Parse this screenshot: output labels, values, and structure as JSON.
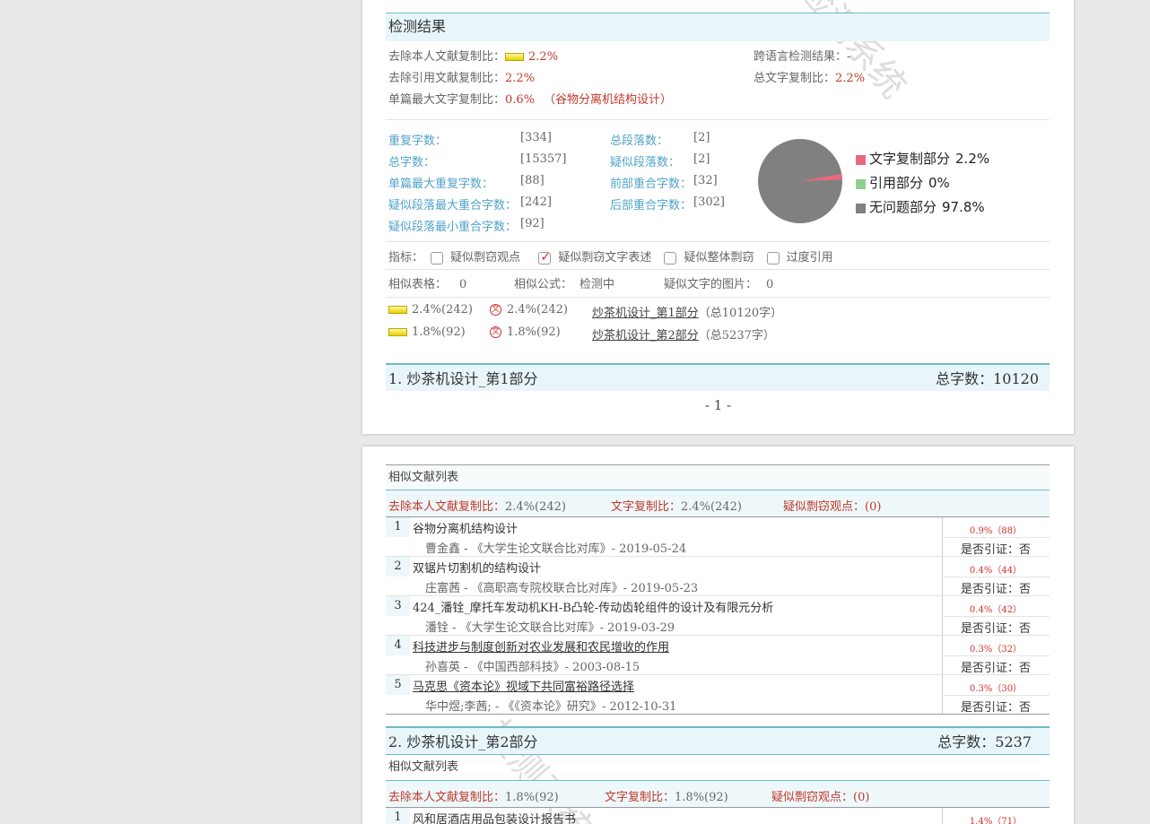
{
  "watermark_text": "检测系统",
  "page1": {
    "section_title": "检测结果",
    "summary": {
      "exclude_self_label": "去除本人文献复制比：",
      "exclude_self_value": "2.2%",
      "cross_lang_label": "跨语言检测结果：",
      "cross_lang_value": "-",
      "exclude_ref_label": "去除引用文献复制比：",
      "exclude_ref_value": "2.2%",
      "total_text_label": "总文字复制比：",
      "total_text_value": "2.2%",
      "single_max_label": "单篇最大文字复制比：",
      "single_max_value": "0.6%",
      "single_max_title": "（谷物分离机结构设计）"
    },
    "stats": {
      "dup_chars_label": "重复字数：",
      "dup_chars_value": "[334]",
      "total_paras_label": "总段落数：",
      "total_paras_value": "[2]",
      "total_chars_label": "总字数：",
      "total_chars_value": "[15357]",
      "sus_paras_label": "疑似段落数：",
      "sus_paras_value": "[2]",
      "single_max_dup_label": "单篇最大重复字数：",
      "single_max_dup_value": "[88]",
      "front_overlap_label": "前部重合字数：",
      "front_overlap_value": "[32]",
      "sus_para_max_label": "疑似段落最大重合字数：",
      "sus_para_max_value": "[242]",
      "back_overlap_label": "后部重合字数：",
      "back_overlap_value": "[302]",
      "sus_para_min_label": "疑似段落最小重合字数：",
      "sus_para_min_value": "[92]"
    },
    "chart_data": {
      "type": "pie",
      "title": "",
      "slices": [
        {
          "label": "文字复制部分",
          "value": 2.2,
          "color": "#e8697d",
          "display": "2.2%"
        },
        {
          "label": "引用部分",
          "value": 0,
          "color": "#8fcf8f",
          "display": "0%"
        },
        {
          "label": "无问题部分",
          "value": 97.8,
          "color": "#808080",
          "display": "97.8%"
        }
      ]
    },
    "indicators": {
      "label": "指标：",
      "items": [
        {
          "text": "疑似剽窃观点",
          "checked": false
        },
        {
          "text": "疑似剽窃文字表述",
          "checked": true
        },
        {
          "text": "疑似整体剽窃",
          "checked": false
        },
        {
          "text": "过度引用",
          "checked": false
        }
      ]
    },
    "similar": {
      "tables_label": "相似表格：",
      "tables_value": "0",
      "formulas_label": "相似公式：",
      "formulas_value": "检测中",
      "images_label": "疑似文字的图片：",
      "images_value": "0"
    },
    "parts": [
      {
        "pct1": "2.4%(242)",
        "pct2": "2.4%(242)",
        "name": "炒茶机设计_第1部分",
        "total": "（总10120字）"
      },
      {
        "pct1": "1.8%(92)",
        "pct2": "1.8%(92)",
        "name": "炒茶机设计_第2部分",
        "total": "（总5237字）"
      }
    ],
    "part_header": {
      "title": "1. 炒茶机设计_第1部分",
      "count": "总字数：10120"
    },
    "page_number": "- 1 -"
  },
  "page2": {
    "list_title": "相似文献列表",
    "summary": {
      "exclude_self_label": "去除本人文献复制比：",
      "exclude_self_value": "2.4%(242)",
      "text_copy_label": "文字复制比：",
      "text_copy_value": "2.4%(242)",
      "sus_points_label": "疑似剽窃观点：",
      "sus_points_value": "(0)"
    },
    "items": [
      {
        "num": "1",
        "title": "谷物分离机结构设计",
        "pct": "0.9%（88）",
        "meta": "曹金鑫 - 《大学生论文联合比对库》- 2019-05-24",
        "cite": "是否引证：否",
        "underline": false
      },
      {
        "num": "2",
        "title": "双锯片切割机的结构设计",
        "pct": "0.4%（44）",
        "meta": "庄富茜 - 《高职高专院校联合比对库》- 2019-05-23",
        "cite": "是否引证：否",
        "underline": false
      },
      {
        "num": "3",
        "title": "424_潘铨_摩托车发动机KH-B凸轮-传动齿轮组件的设计及有限元分析",
        "pct": "0.4%（42）",
        "meta": "潘铨 - 《大学生论文联合比对库》- 2019-03-29",
        "cite": "是否引证：否",
        "underline": false
      },
      {
        "num": "4",
        "title": "科技进步与制度创新对农业发展和农民增收的作用",
        "pct": "0.3%（32）",
        "meta": "孙喜英 - 《中国西部科技》- 2003-08-15",
        "cite": "是否引证：否",
        "underline": true
      },
      {
        "num": "5",
        "title": "马克思《资本论》视域下共同富裕路径选择",
        "pct": "0.3%（30）",
        "meta": "华中煜;李茜; - 《《资本论》研究》- 2012-10-31",
        "cite": "是否引证：否",
        "underline": true
      }
    ],
    "part2_header": {
      "title": "2. 炒茶机设计_第2部分",
      "count": "总字数：5237"
    },
    "list2_title": "相似文献列表",
    "summary2": {
      "exclude_self_label": "去除本人文献复制比：",
      "exclude_self_value": "1.8%(92)",
      "text_copy_label": "文字复制比：",
      "text_copy_value": "1.8%(92)",
      "sus_points_label": "疑似剽窃观点：",
      "sus_points_value": "(0)"
    },
    "items2": [
      {
        "num": "1",
        "title": "风和居酒店用品包装设计报告书",
        "pct": "1.4%（71）"
      }
    ]
  }
}
